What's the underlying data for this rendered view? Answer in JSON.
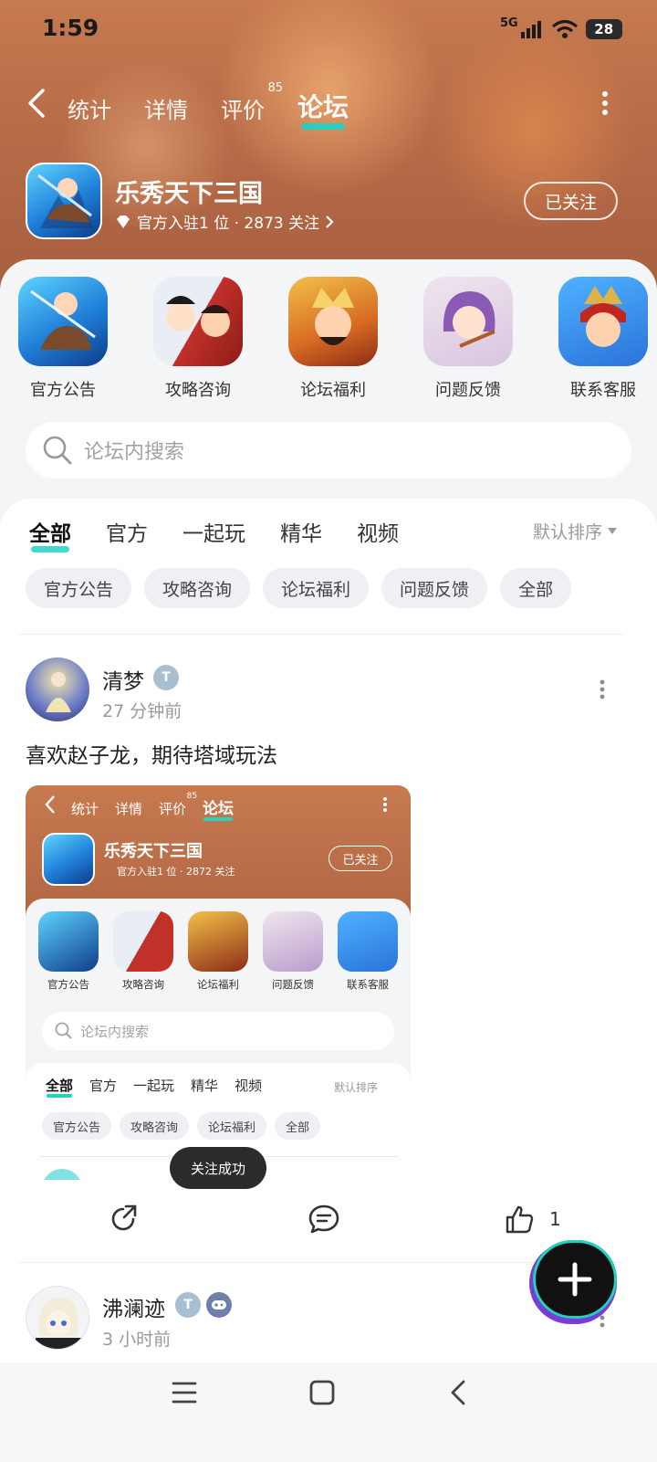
{
  "status_bar": {
    "time": "1:59",
    "network": "5G",
    "battery": "28",
    "icons": [
      "signal-icon",
      "wifi-icon",
      "battery-icon"
    ]
  },
  "top_tabs": {
    "items": [
      {
        "label": "统计"
      },
      {
        "label": "详情"
      },
      {
        "label": "评价",
        "badge": "85"
      },
      {
        "label": "论坛"
      }
    ],
    "active": "论坛"
  },
  "app_header": {
    "name": "乐秀天下三国",
    "meta": "官方入驻1 位 · 2873 关注",
    "follow_button": "已关注"
  },
  "categories": [
    {
      "label": "官方公告"
    },
    {
      "label": "攻略咨询"
    },
    {
      "label": "论坛福利"
    },
    {
      "label": "问题反馈"
    },
    {
      "label": "联系客服"
    }
  ],
  "search": {
    "placeholder": "论坛内搜索"
  },
  "feed_tabs": {
    "items": [
      "全部",
      "官方",
      "一起玩",
      "精华",
      "视频"
    ],
    "active": "全部",
    "sort": "默认排序"
  },
  "chips": [
    "官方公告",
    "攻略咨询",
    "论坛福利",
    "问题反馈",
    "全部"
  ],
  "post": {
    "author": "清梦",
    "time": "27 分钟前",
    "text": "喜欢赵子龙，期待塔域玩法",
    "screenshot": {
      "tabs": [
        "统计",
        "详情",
        "评价",
        "论坛"
      ],
      "badge": "85",
      "app_name": "乐秀天下三国",
      "meta": "官方入驻1 位 · 2872 关注",
      "follow": "已关注",
      "categories": [
        "官方公告",
        "攻略咨询",
        "论坛福利",
        "问题反馈",
        "联系客服"
      ],
      "search_placeholder": "论坛内搜索",
      "feed_tabs": [
        "全部",
        "官方",
        "一起玩",
        "精华",
        "视频"
      ],
      "sort": "默认排序",
      "chips": [
        "官方公告",
        "攻略咨询",
        "论坛福利",
        "全部"
      ],
      "toast": "关注成功"
    },
    "like_count": "1"
  },
  "post2": {
    "author": "沸澜迹",
    "time": "3 小时前"
  },
  "colors": {
    "accent": "#22d1c2",
    "header_bg": "#b76c48",
    "chip_bg": "#eef0f3"
  }
}
